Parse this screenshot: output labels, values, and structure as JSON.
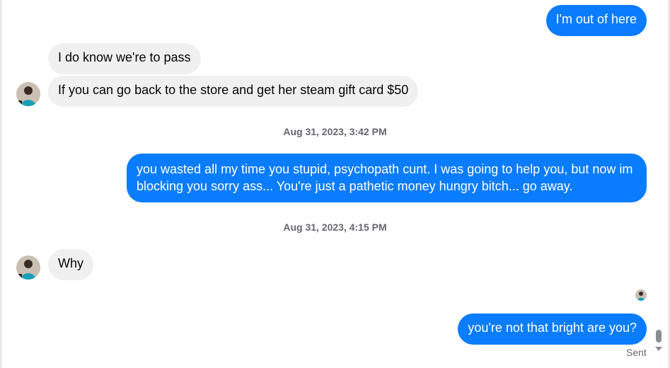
{
  "messages": [
    {
      "direction": "outgoing",
      "text": "I'm out of here"
    },
    {
      "direction": "incoming",
      "text": "I do know we're to pass"
    },
    {
      "direction": "incoming",
      "text": "If you can go back to the store and get her steam gift card $50"
    },
    {
      "direction": "outgoing",
      "text": "you wasted all my time you stupid, psychopath cunt. I was going to help you, but now im blocking you sorry ass... You're just a pathetic money hungry bitch... go away."
    },
    {
      "direction": "incoming",
      "text": "Why"
    },
    {
      "direction": "outgoing",
      "text": "you're not that bright are you?"
    }
  ],
  "timestamps": [
    "Aug 31, 2023, 3:42 PM",
    "Aug 31, 2023, 4:15 PM"
  ],
  "status": "Sent",
  "colors": {
    "outgoing_bubble": "#0a7cff",
    "incoming_bubble": "#f0f0f0",
    "timestamp_text": "#65676b"
  },
  "icons": {
    "contact_avatar": "profile-photo",
    "read_receipt": "seen-avatar",
    "scroll": "scrollbar"
  }
}
